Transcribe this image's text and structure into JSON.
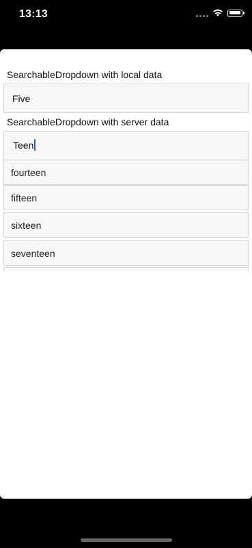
{
  "status_bar": {
    "time": "13:13"
  },
  "local_section": {
    "label": "SearchableDropdown with local data",
    "value": "Five"
  },
  "server_section": {
    "label": "SearchableDropdown with server data",
    "value": "Teen",
    "options": [
      "fourteen",
      "fifteen",
      "sixteen",
      "seventeen"
    ]
  },
  "icons": [
    "signal-icon",
    "wifi-icon",
    "battery-icon"
  ]
}
